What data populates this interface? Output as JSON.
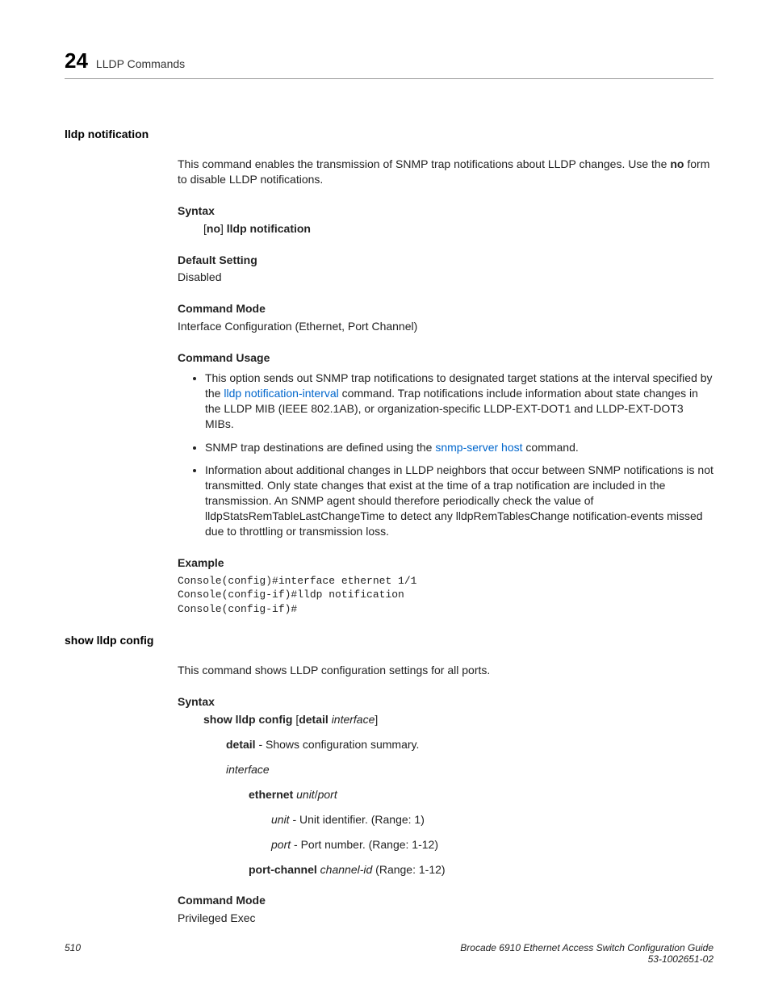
{
  "header": {
    "chapter_number": "24",
    "chapter_title": "LLDP Commands"
  },
  "section1": {
    "name": "lldp notification",
    "intro_part1": "This command enables the transmission of SNMP trap notifications about LLDP changes. Use the ",
    "intro_bold": "no",
    "intro_part2": " form to disable LLDP notifications.",
    "syntax_label": "Syntax",
    "syntax_b1": "[",
    "syntax_bold1": "no",
    "syntax_b2": "] ",
    "syntax_bold2": "lldp notification",
    "default_setting_label": "Default Setting",
    "default_setting_value": "Disabled",
    "command_mode_label": "Command Mode",
    "command_mode_value": "Interface Configuration (Ethernet, Port Channel)",
    "command_usage_label": "Command Usage",
    "bullet1_a": "This option sends out SNMP trap notifications to designated target stations at the interval specified by the ",
    "bullet1_link": "lldp notification-interval",
    "bullet1_b": " command. Trap notifications include information about state changes in the LLDP MIB (IEEE 802.1AB), or organization-specific LLDP-EXT-DOT1 and LLDP-EXT-DOT3 MIBs.",
    "bullet2_a": "SNMP trap destinations are defined using the ",
    "bullet2_link": "snmp-server host",
    "bullet2_b": " command.",
    "bullet3": "Information about additional changes in LLDP neighbors that occur between SNMP notifications is not transmitted. Only state changes that exist at the time of a trap notification are included in the transmission. An SNMP agent should therefore periodically check the value of lldpStatsRemTableLastChangeTime to detect any lldpRemTablesChange notification-events missed due to throttling or transmission loss.",
    "example_label": "Example",
    "example_code": "Console(config)#interface ethernet 1/1\nConsole(config-if)#lldp notification\nConsole(config-if)#"
  },
  "section2": {
    "name": "show lldp config",
    "intro": "This command shows LLDP configuration settings for all ports.",
    "syntax_label": "Syntax",
    "syntax_bold": "show lldp config",
    "syntax_b1": " [",
    "syntax_bold2": "detail",
    "syntax_b2": " ",
    "syntax_italic": "interface",
    "syntax_b3": "]",
    "detail_bold": "detail",
    "detail_text": " - Shows configuration summary.",
    "interface_italic": "interface",
    "eth_bold": "ethernet",
    "eth_sp": " ",
    "eth_it1": "unit",
    "eth_slash": "/",
    "eth_it2": "port",
    "unit_it": "unit",
    "unit_text": " - Unit identifier. (Range: 1)",
    "port_it": "port",
    "port_text": " - Port number. (Range: 1-12)",
    "pc_bold": "port-channel",
    "pc_sp": " ",
    "pc_it": "channel-id",
    "pc_text": " (Range: 1-12)",
    "command_mode_label": "Command Mode",
    "command_mode_value": "Privileged Exec"
  },
  "footer": {
    "page_number": "510",
    "doc_title": "Brocade 6910 Ethernet Access Switch Configuration Guide",
    "doc_id": "53-1002651-02"
  }
}
